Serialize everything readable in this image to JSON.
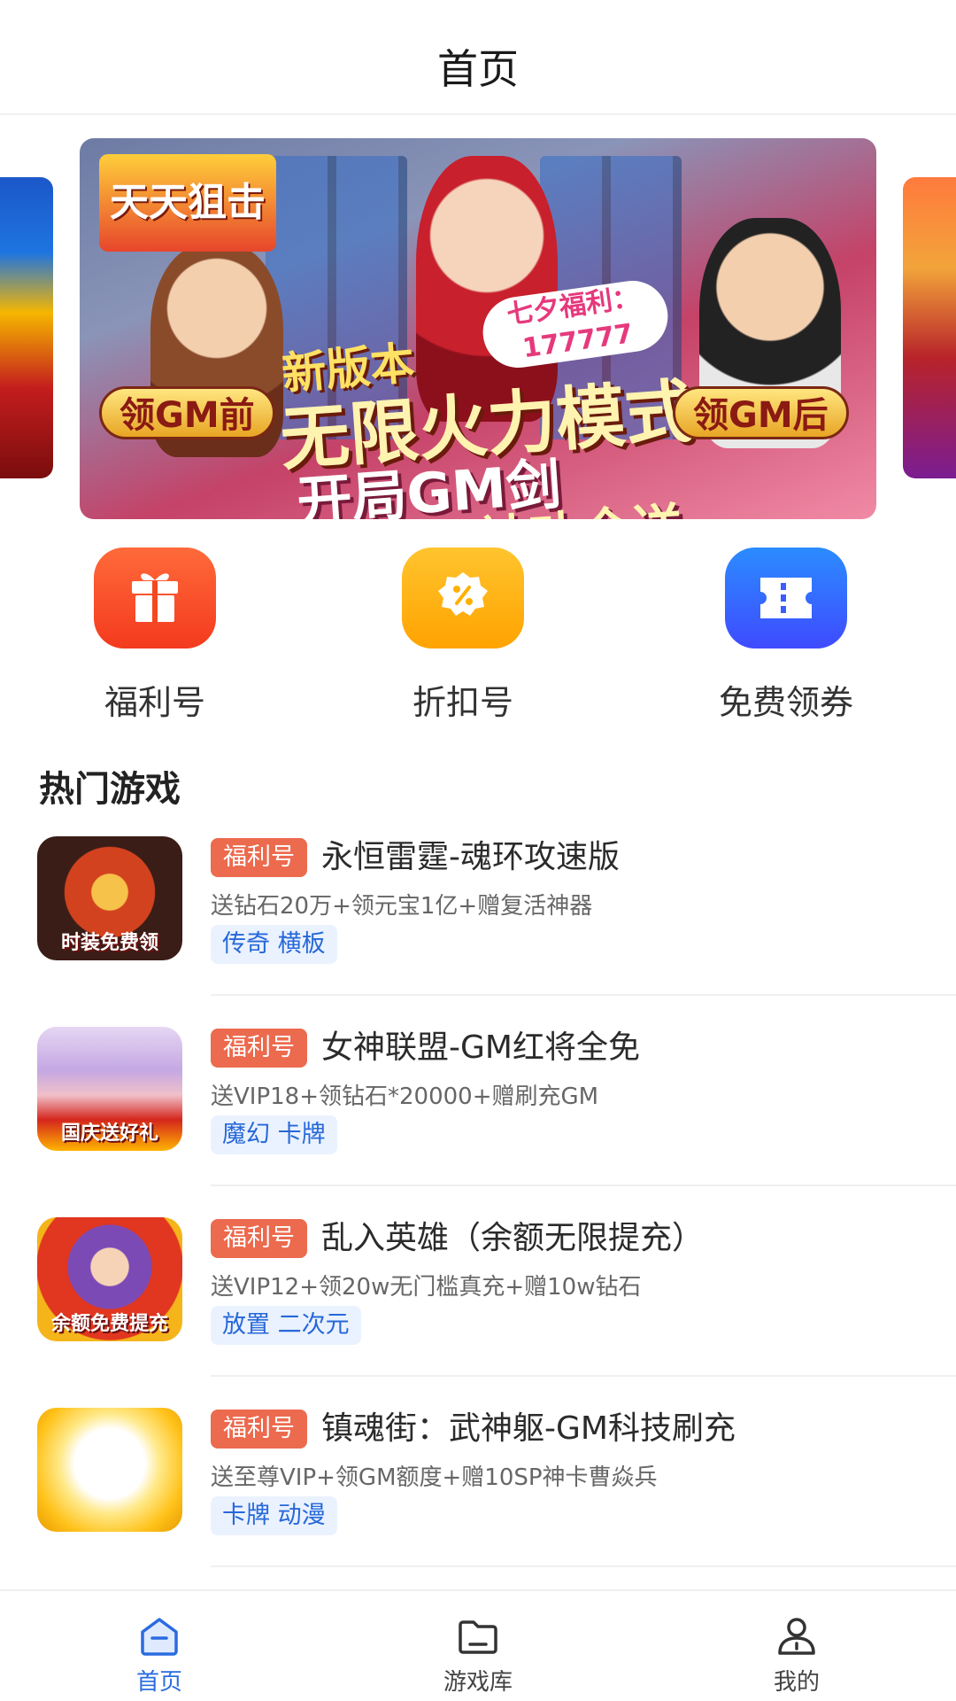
{
  "header": {
    "title": "首页"
  },
  "banner": {
    "logo_text": "天天狙击",
    "badge_text": "七夕福利：177777",
    "headline_small": "新版本",
    "headline_main": "无限火力模式",
    "pill_left": "领GM前",
    "pill_right": "领GM后",
    "sub1": "开局GM剑",
    "sub2": "神功全送"
  },
  "quick_entries": [
    {
      "label": "福利号",
      "icon": "gift-icon",
      "color": "#f4481f"
    },
    {
      "label": "折扣号",
      "icon": "discount-icon",
      "color": "#ffb000"
    },
    {
      "label": "免费领券",
      "icon": "coupon-icon",
      "color": "#2f6cff"
    }
  ],
  "section": {
    "title": "热门游戏"
  },
  "games": [
    {
      "tag": "福利号",
      "name": "永恒雷霆-魂环攻速版",
      "desc": "送钻石20万+领元宝1亿+赠复活神器",
      "genre": "传奇 横板",
      "thumb_caption": "时装免费领"
    },
    {
      "tag": "福利号",
      "name": "女神联盟-GM红将全免",
      "desc": "送VIP18+领钻石*20000+赠刷充GM",
      "genre": "魔幻 卡牌",
      "thumb_caption": "国庆送好礼"
    },
    {
      "tag": "福利号",
      "name": "乱入英雄（余额无限提充）",
      "desc": "送VIP12+领20w无门槛真充+赠10w钻石",
      "genre": "放置 二次元",
      "thumb_caption": "余额免费提充"
    },
    {
      "tag": "福利号",
      "name": "镇魂街：武神躯-GM科技刷充",
      "desc": "送至尊VIP+领GM额度+赠10SP神卡曹焱兵",
      "genre": "卡牌 动漫",
      "thumb_caption": ""
    }
  ],
  "tabbar": {
    "items": [
      {
        "label": "首页",
        "icon": "home-icon",
        "active": true
      },
      {
        "label": "游戏库",
        "icon": "folder-icon",
        "active": false
      },
      {
        "label": "我的",
        "icon": "user-icon",
        "active": false
      }
    ],
    "active_color": "#2a6be0"
  }
}
